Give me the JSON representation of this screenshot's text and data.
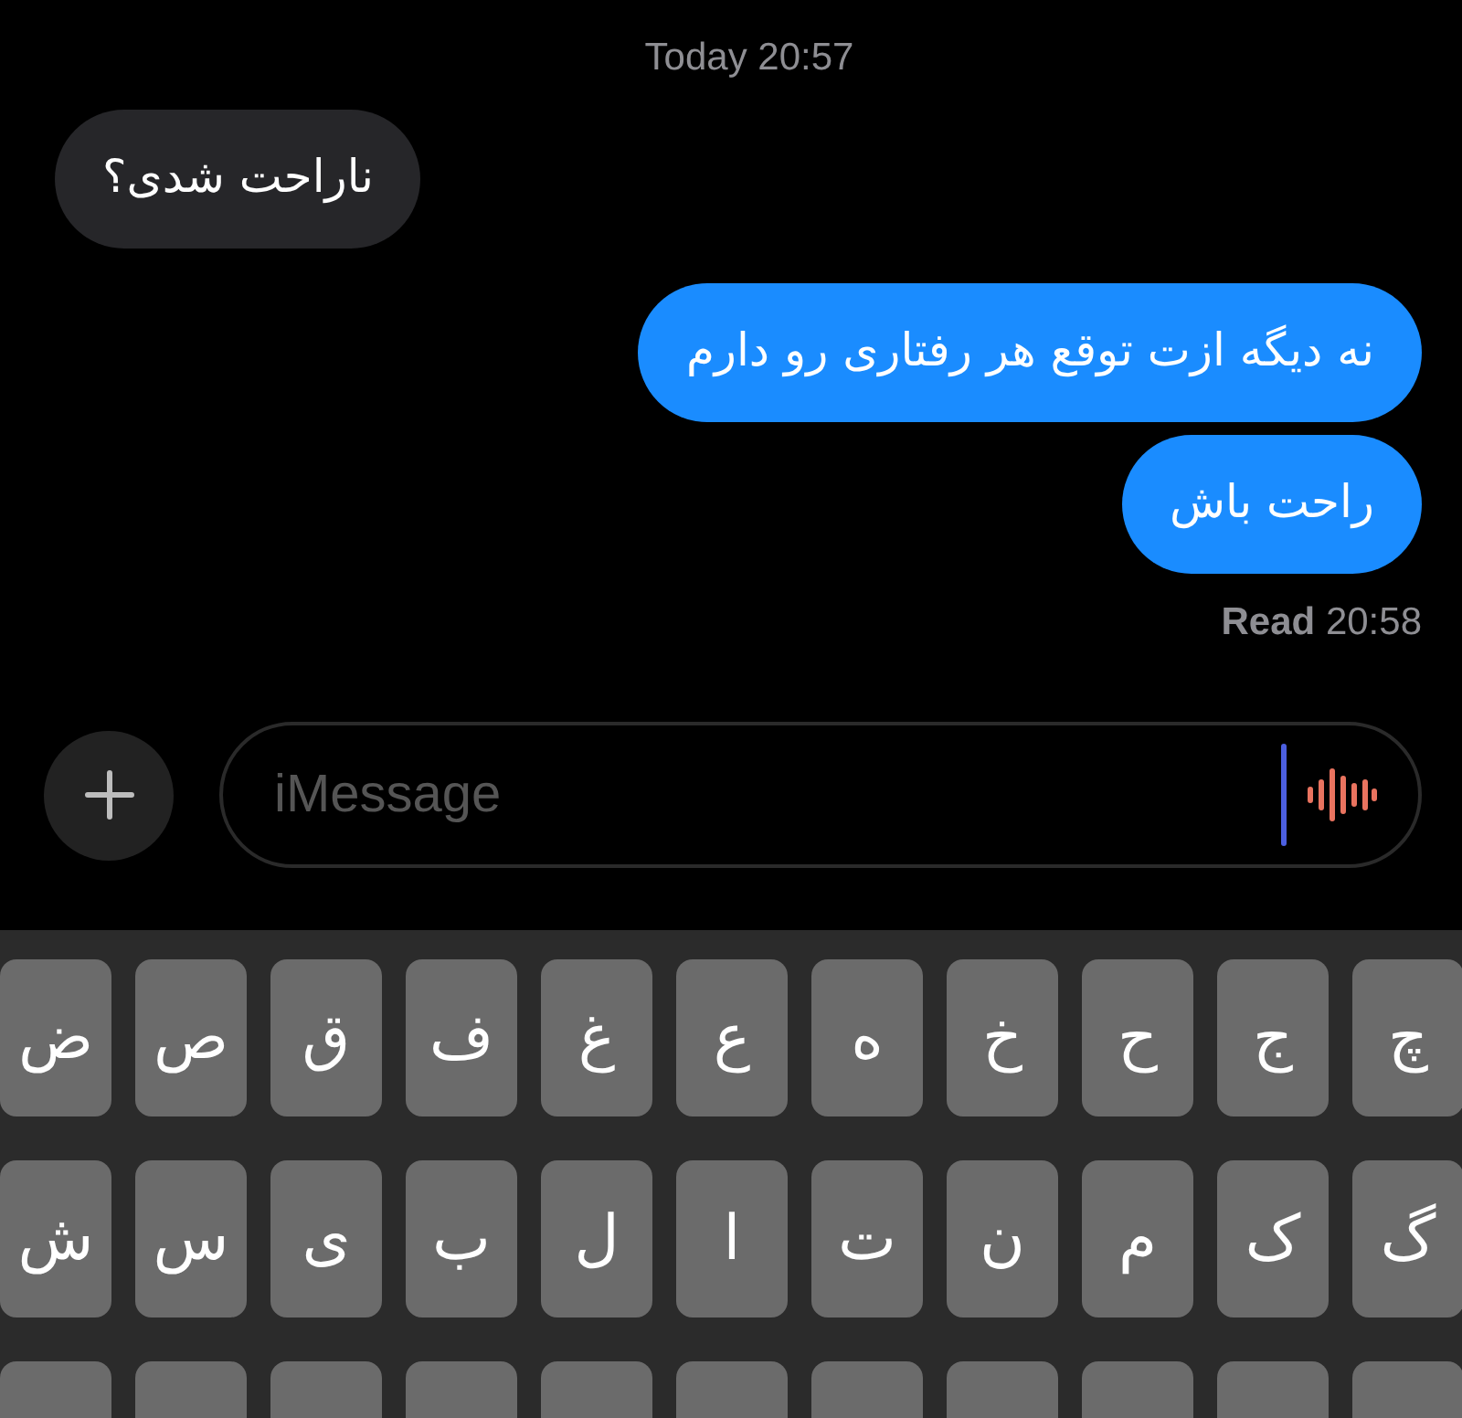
{
  "timestamp": "Today 20:57",
  "messages": [
    {
      "kind": "received",
      "text": "ناراحت شدی؟"
    },
    {
      "kind": "sent",
      "text": "نه دیگه ازت توقع هر رفتاری رو دارم"
    },
    {
      "kind": "sent",
      "text": "راحت باش"
    }
  ],
  "read_receipt": {
    "label": "Read",
    "time": "20:58"
  },
  "compose": {
    "placeholder": "iMessage"
  },
  "keyboard": {
    "rows": [
      [
        "چ",
        "ج",
        "ح",
        "خ",
        "ه",
        "ع",
        "غ",
        "ف",
        "ق",
        "ص",
        "ض"
      ],
      [
        "گ",
        "ک",
        "م",
        "ن",
        "ت",
        "ا",
        "ل",
        "ب",
        "ی",
        "س",
        "ش"
      ]
    ]
  }
}
